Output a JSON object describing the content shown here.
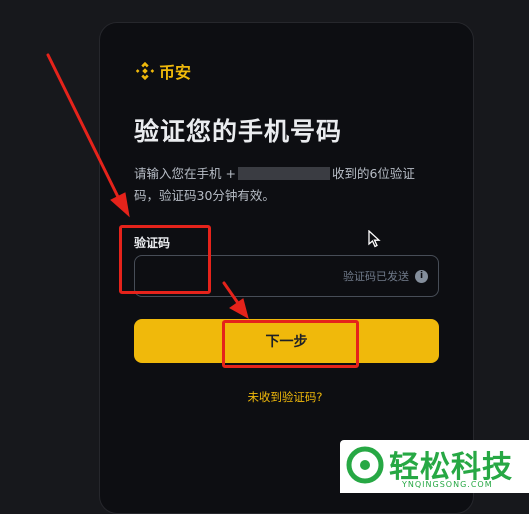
{
  "brand": {
    "name": "币安",
    "color": "#f0b90b"
  },
  "page": {
    "title": "验证您的手机号码",
    "desc_part1": "请输入您在手机 +",
    "desc_part2": "收到的6位验证码，验证码30分钟有效。"
  },
  "form": {
    "field_label": "验证码",
    "code_value": "",
    "sent_hint": "验证码已发送",
    "next_label": "下一步",
    "not_received": "未收到验证码?"
  },
  "icons": {
    "logo": "binance-logo-icon",
    "info": "info-icon",
    "cursor": "mouse-cursor-icon"
  },
  "annotation": {
    "color": "#e5231b"
  },
  "watermark": {
    "cn": "轻松科技",
    "en": "YNQINGSONG.COM",
    "color": "#27a844"
  }
}
